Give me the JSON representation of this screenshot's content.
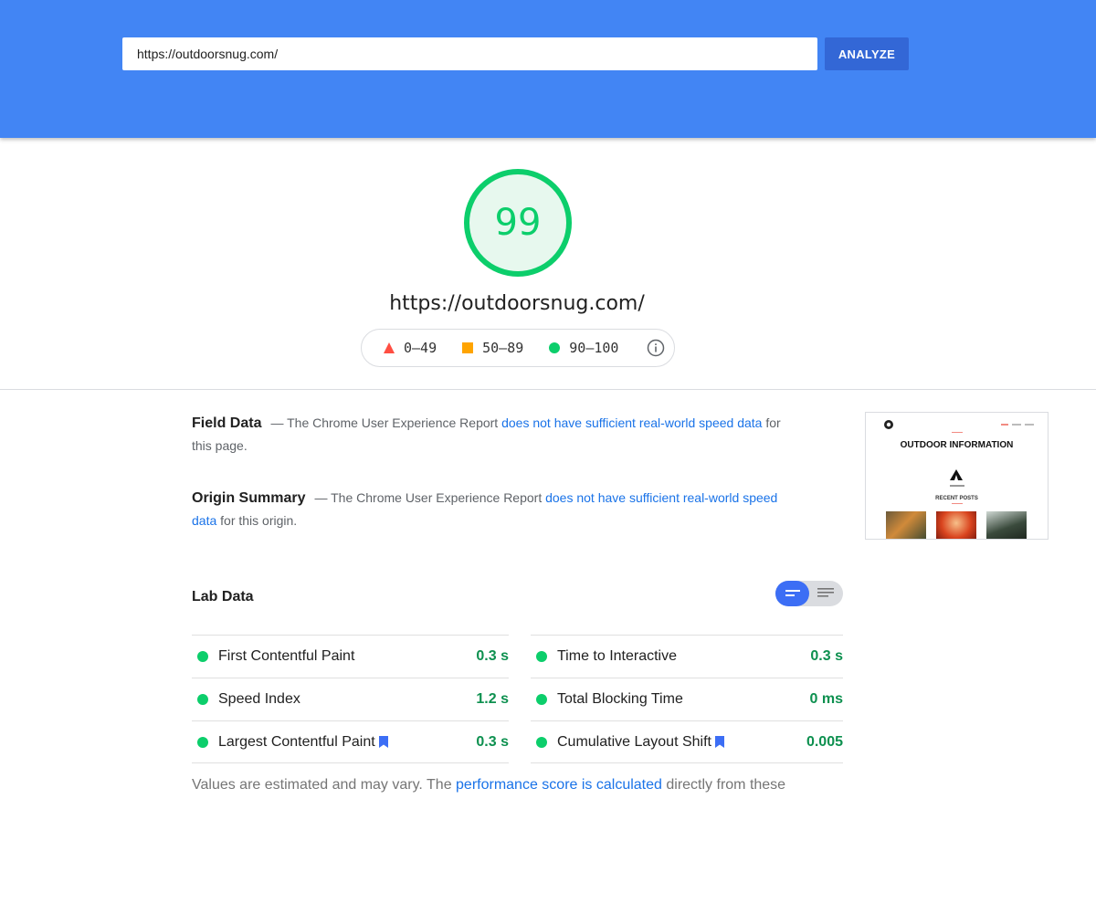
{
  "search": {
    "url_value": "https://outdoorsnug.com/",
    "analyze_label": "ANALYZE"
  },
  "score": {
    "value": "99",
    "color": "#0cce6b",
    "page_url": "https://outdoorsnug.com/"
  },
  "legend": {
    "fail": "0–49",
    "average": "50–89",
    "pass": "90–100",
    "info_icon": "info-icon"
  },
  "field_data": {
    "title": "Field Data",
    "text_before": "— The Chrome User Experience Report ",
    "link": "does not have sufficient real-world speed data",
    "text_after": " for this page."
  },
  "origin_summary": {
    "title": "Origin Summary",
    "text_before": "— The Chrome User Experience Report ",
    "link": "does not have sufficient real-world speed data",
    "text_after": " for this origin."
  },
  "thumbnail": {
    "title": "OUTDOOR INFORMATION",
    "subtitle": "RECENT POSTS"
  },
  "lab_data": {
    "title": "Lab Data",
    "left_metrics": [
      {
        "name": "First Contentful Paint",
        "value": "0.3 s"
      },
      {
        "name": "Speed Index",
        "value": "1.2 s"
      },
      {
        "name": "Largest Contentful Paint",
        "value": "0.3 s"
      }
    ],
    "right_metrics": [
      {
        "name": "Time to Interactive",
        "value": "0.3 s"
      },
      {
        "name": "Total Blocking Time",
        "value": "0 ms"
      },
      {
        "name": "Cumulative Layout Shift",
        "value": "0.005"
      }
    ]
  },
  "footnote": {
    "text_before": "Values are estimated and may vary. The ",
    "link": "performance score is calculated",
    "text_after": " directly from these"
  },
  "colors": {
    "header": "#4285f4",
    "analyze_button": "#3367d6",
    "pass_green": "#0cce6b",
    "value_green": "#0d904f",
    "link_blue": "#1a73e8"
  }
}
